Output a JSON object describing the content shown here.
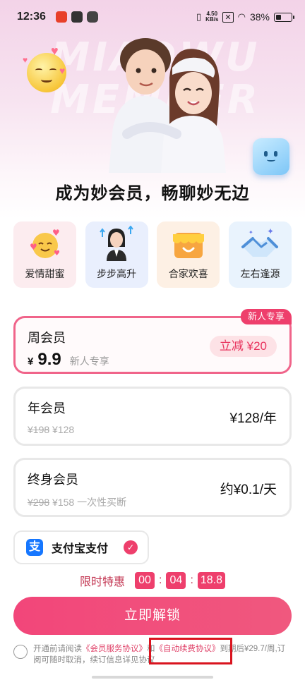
{
  "status_bar": {
    "time": "12:36",
    "net_speed_value": "4.50",
    "net_speed_unit": "KB/s",
    "battery": "38%"
  },
  "hero": {
    "watermark": "MIAOWU MEMBER",
    "headline": "成为妙会员，畅聊妙无边"
  },
  "perks": [
    {
      "label": "爱情甜蜜",
      "icon": "love-emoji-icon"
    },
    {
      "label": "步步高升",
      "icon": "career-person-icon"
    },
    {
      "label": "合家欢喜",
      "icon": "shop-awning-icon"
    },
    {
      "label": "左右逢源",
      "icon": "handshake-icon"
    }
  ],
  "plans": {
    "week": {
      "title": "周会员",
      "currency": "¥",
      "price": "9.9",
      "tag": "新人专享",
      "save": "立减 ¥20",
      "badge": "新人专享",
      "selected": true
    },
    "year": {
      "title": "年会员",
      "original": "¥198",
      "current": "¥128",
      "right": "¥128/年"
    },
    "lifetime": {
      "title": "终身会员",
      "original": "¥298",
      "current": "¥158 一次性买断",
      "right": "约¥0.1/天"
    }
  },
  "payment": {
    "icon_glyph": "支",
    "label": "支付宝支付",
    "selected": true
  },
  "countdown": {
    "label": "限时特惠",
    "hours": "00",
    "minutes": "04",
    "seconds": "18.8"
  },
  "cta": {
    "label": "立即解锁"
  },
  "agreement": {
    "prefix": "开通前请阅读",
    "link1": "《会员服务协议》",
    "and": "和",
    "link2": "《自动续费协议》",
    "suffix": "到期后¥29.7/周,订阅可随时取消，续订信息详见协议"
  },
  "colors": {
    "accent": "#ee3f6c",
    "link": "#e0456b",
    "highlight_box": "#d9141f"
  }
}
